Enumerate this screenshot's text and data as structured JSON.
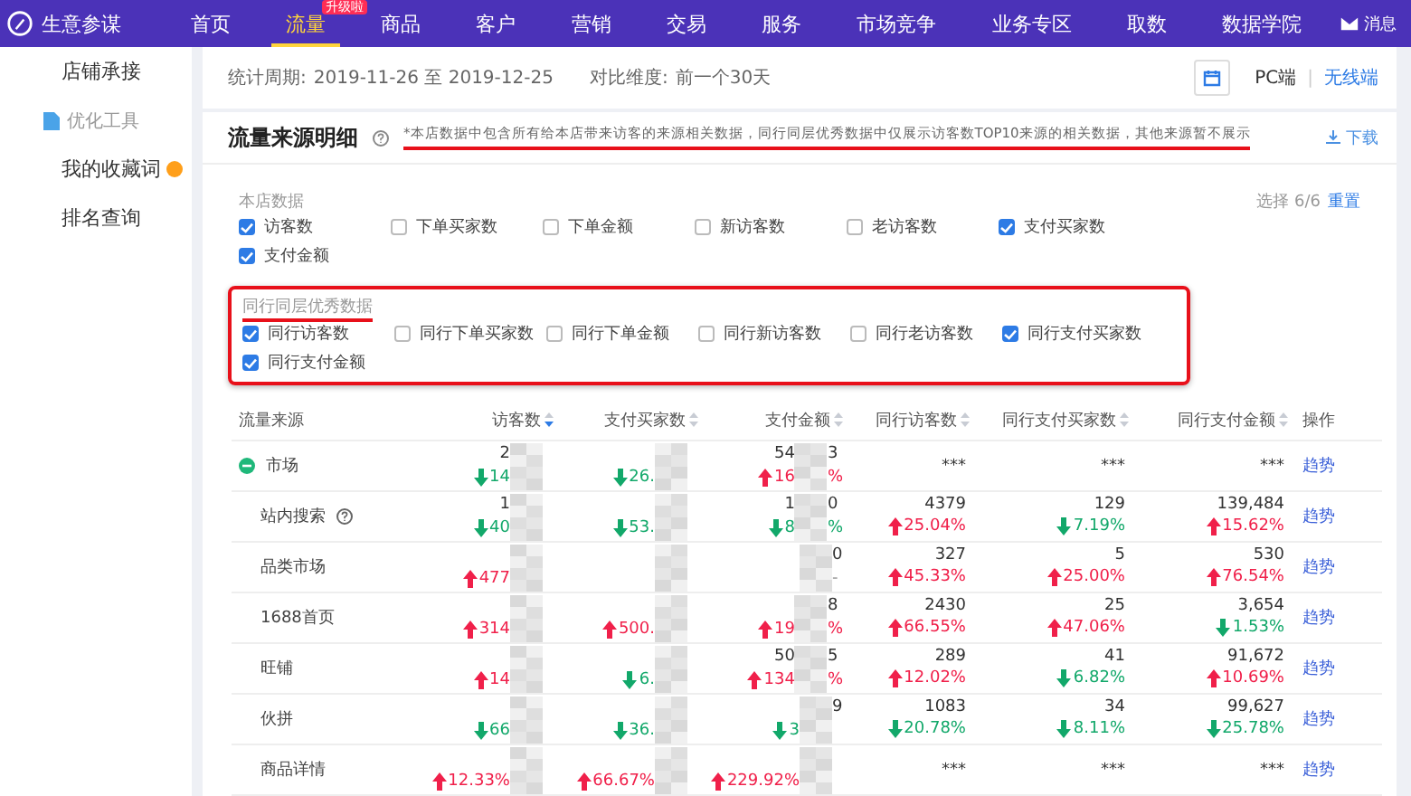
{
  "nav": {
    "logo": "生意参谋",
    "messages": "消息",
    "items": [
      {
        "label": "首页",
        "selected": false
      },
      {
        "label": "流量",
        "selected": true,
        "badge": "升级啦"
      },
      {
        "label": "商品",
        "selected": false
      },
      {
        "label": "客户",
        "selected": false
      },
      {
        "label": "营销",
        "selected": false
      },
      {
        "label": "交易",
        "selected": false
      },
      {
        "label": "服务",
        "selected": false
      },
      {
        "label": "市场竞争",
        "selected": false
      },
      {
        "label": "业务专区",
        "selected": false
      },
      {
        "label": "取数",
        "selected": false
      },
      {
        "label": "数据学院",
        "selected": false
      }
    ]
  },
  "sidebar": {
    "items": [
      {
        "kind": "link",
        "label": "店铺承接"
      },
      {
        "kind": "group",
        "label": "优化工具"
      },
      {
        "kind": "link",
        "label": "我的收藏词",
        "dot": true
      },
      {
        "kind": "link",
        "label": "排名查询"
      }
    ]
  },
  "period": {
    "label": "统计周期:",
    "value": "2019-11-26 至 2019-12-25",
    "compare_label": "对比维度:",
    "compare_value": "前一个30天",
    "separator": "|",
    "devices": [
      {
        "label": "PC端",
        "selected": true
      },
      {
        "label": "无线端",
        "selected": false
      }
    ]
  },
  "section": {
    "title": "流量来源明细",
    "note": "*本店数据中包含所有给本店带来访客的来源相关数据，同行同层优秀数据中仅展示访客数TOP10来源的相关数据，其他来源暂不展示",
    "download": "下载",
    "selection": "选择 6/6",
    "reset": "重置"
  },
  "filter_groups": [
    {
      "title": "本店数据",
      "highlighted": false,
      "options": [
        {
          "label": "访客数",
          "checked": true
        },
        {
          "label": "下单买家数",
          "checked": false
        },
        {
          "label": "下单金额",
          "checked": false
        },
        {
          "label": "新访客数",
          "checked": false
        },
        {
          "label": "老访客数",
          "checked": false
        },
        {
          "label": "支付买家数",
          "checked": true
        },
        {
          "label": "支付金额",
          "checked": true
        }
      ]
    },
    {
      "title": "同行同层优秀数据",
      "highlighted": true,
      "options": [
        {
          "label": "同行访客数",
          "checked": true
        },
        {
          "label": "同行下单买家数",
          "checked": false
        },
        {
          "label": "同行下单金额",
          "checked": false
        },
        {
          "label": "同行新访客数",
          "checked": false
        },
        {
          "label": "同行老访客数",
          "checked": false
        },
        {
          "label": "同行支付买家数",
          "checked": true
        },
        {
          "label": "同行支付金额",
          "checked": true
        }
      ]
    }
  ],
  "table": {
    "columns": [
      {
        "label": "流量来源"
      },
      {
        "label": "访客数",
        "sortable": true,
        "sorted": true
      },
      {
        "label": "支付买家数",
        "sortable": true,
        "sorted": false
      },
      {
        "label": "支付金额",
        "sortable": true,
        "sorted": false
      },
      {
        "label": "同行访客数",
        "sortable": true,
        "sorted": false
      },
      {
        "label": "同行支付买家数",
        "sortable": true,
        "sorted": false
      },
      {
        "label": "同行支付金额",
        "sortable": true,
        "sorted": false
      },
      {
        "label": "操作"
      }
    ],
    "rows": [
      {
        "cells": [
          {
            "kind": "source",
            "text": "市场",
            "expanded": true
          },
          {
            "kind": "masked",
            "value": "2",
            "change": "14",
            "rising": false
          },
          {
            "kind": "masked",
            "change": "26.",
            "rising": false
          },
          {
            "kind": "masked",
            "value": "54",
            "tail": "3",
            "change": "16",
            "change_tail": "%",
            "rising": true
          },
          {
            "kind": "plain",
            "value": "***"
          },
          {
            "kind": "plain",
            "value": "***"
          },
          {
            "kind": "plain",
            "value": "***"
          },
          {
            "kind": "link",
            "text": "趋势"
          }
        ],
        "children": [
          {
            "cells": [
              {
                "kind": "source",
                "text": "站内搜索",
                "help": true
              },
              {
                "kind": "masked",
                "value": "1",
                "change": "40",
                "rising": false
              },
              {
                "kind": "masked",
                "change": "53.",
                "rising": false
              },
              {
                "kind": "masked",
                "value": "1",
                "tail": "0",
                "change": "8",
                "change_tail": "%",
                "rising": false
              },
              {
                "kind": "plain",
                "value": "4379",
                "change": "25.04%",
                "rising": true
              },
              {
                "kind": "plain",
                "value": "129",
                "change": "7.19%",
                "rising": false
              },
              {
                "kind": "plain",
                "value": "139,484",
                "change": "15.62%",
                "rising": true
              },
              {
                "kind": "link",
                "text": "趋势"
              }
            ]
          },
          {
            "cells": [
              {
                "kind": "source",
                "text": "品类市场"
              },
              {
                "kind": "masked",
                "change": "477",
                "rising": true
              },
              {
                "kind": "masked"
              },
              {
                "kind": "masked",
                "tail": "0",
                "change_tail": "-"
              },
              {
                "kind": "plain",
                "value": "327",
                "change": "45.33%",
                "rising": true
              },
              {
                "kind": "plain",
                "value": "5",
                "change": "25.00%",
                "rising": true
              },
              {
                "kind": "plain",
                "value": "530",
                "change": "76.54%",
                "rising": true
              },
              {
                "kind": "link",
                "text": "趋势"
              }
            ]
          },
          {
            "cells": [
              {
                "kind": "source",
                "text": "1688首页"
              },
              {
                "kind": "masked",
                "change": "314",
                "rising": true
              },
              {
                "kind": "masked",
                "change": "500.",
                "rising": true
              },
              {
                "kind": "masked",
                "tail": "8",
                "change": "19",
                "change_tail": "%",
                "rising": true
              },
              {
                "kind": "plain",
                "value": "2430",
                "change": "66.55%",
                "rising": true
              },
              {
                "kind": "plain",
                "value": "25",
                "change": "47.06%",
                "rising": true
              },
              {
                "kind": "plain",
                "value": "3,654",
                "change": "1.53%",
                "rising": false
              },
              {
                "kind": "link",
                "text": "趋势"
              }
            ]
          },
          {
            "cells": [
              {
                "kind": "source",
                "text": "旺铺"
              },
              {
                "kind": "masked",
                "change": "14",
                "rising": true
              },
              {
                "kind": "masked",
                "change": "6.",
                "rising": false
              },
              {
                "kind": "masked",
                "value": "50",
                "tail": "5",
                "change": "134",
                "change_tail": "%",
                "rising": true
              },
              {
                "kind": "plain",
                "value": "289",
                "change": "12.02%",
                "rising": true
              },
              {
                "kind": "plain",
                "value": "41",
                "change": "6.82%",
                "rising": false
              },
              {
                "kind": "plain",
                "value": "91,672",
                "change": "10.69%",
                "rising": true
              },
              {
                "kind": "link",
                "text": "趋势"
              }
            ]
          },
          {
            "cells": [
              {
                "kind": "source",
                "text": "伙拼"
              },
              {
                "kind": "masked",
                "change": "66",
                "rising": false
              },
              {
                "kind": "masked",
                "change": "36.",
                "rising": false
              },
              {
                "kind": "masked",
                "tail": "9",
                "change": "3",
                "rising": false
              },
              {
                "kind": "plain",
                "value": "1083",
                "change": "20.78%",
                "rising": false
              },
              {
                "kind": "plain",
                "value": "34",
                "change": "8.11%",
                "rising": false
              },
              {
                "kind": "plain",
                "value": "99,627",
                "change": "25.78%",
                "rising": false
              },
              {
                "kind": "link",
                "text": "趋势"
              }
            ]
          },
          {
            "cells": [
              {
                "kind": "source",
                "text": "商品详情"
              },
              {
                "kind": "masked",
                "change": "12.33%",
                "rising": true
              },
              {
                "kind": "masked",
                "change": "66.67%",
                "rising": true
              },
              {
                "kind": "masked",
                "change": "229.92%",
                "rising": true
              },
              {
                "kind": "plain",
                "value": "***"
              },
              {
                "kind": "plain",
                "value": "***"
              },
              {
                "kind": "plain",
                "value": "***"
              },
              {
                "kind": "link",
                "text": "趋势"
              }
            ]
          }
        ]
      }
    ]
  }
}
